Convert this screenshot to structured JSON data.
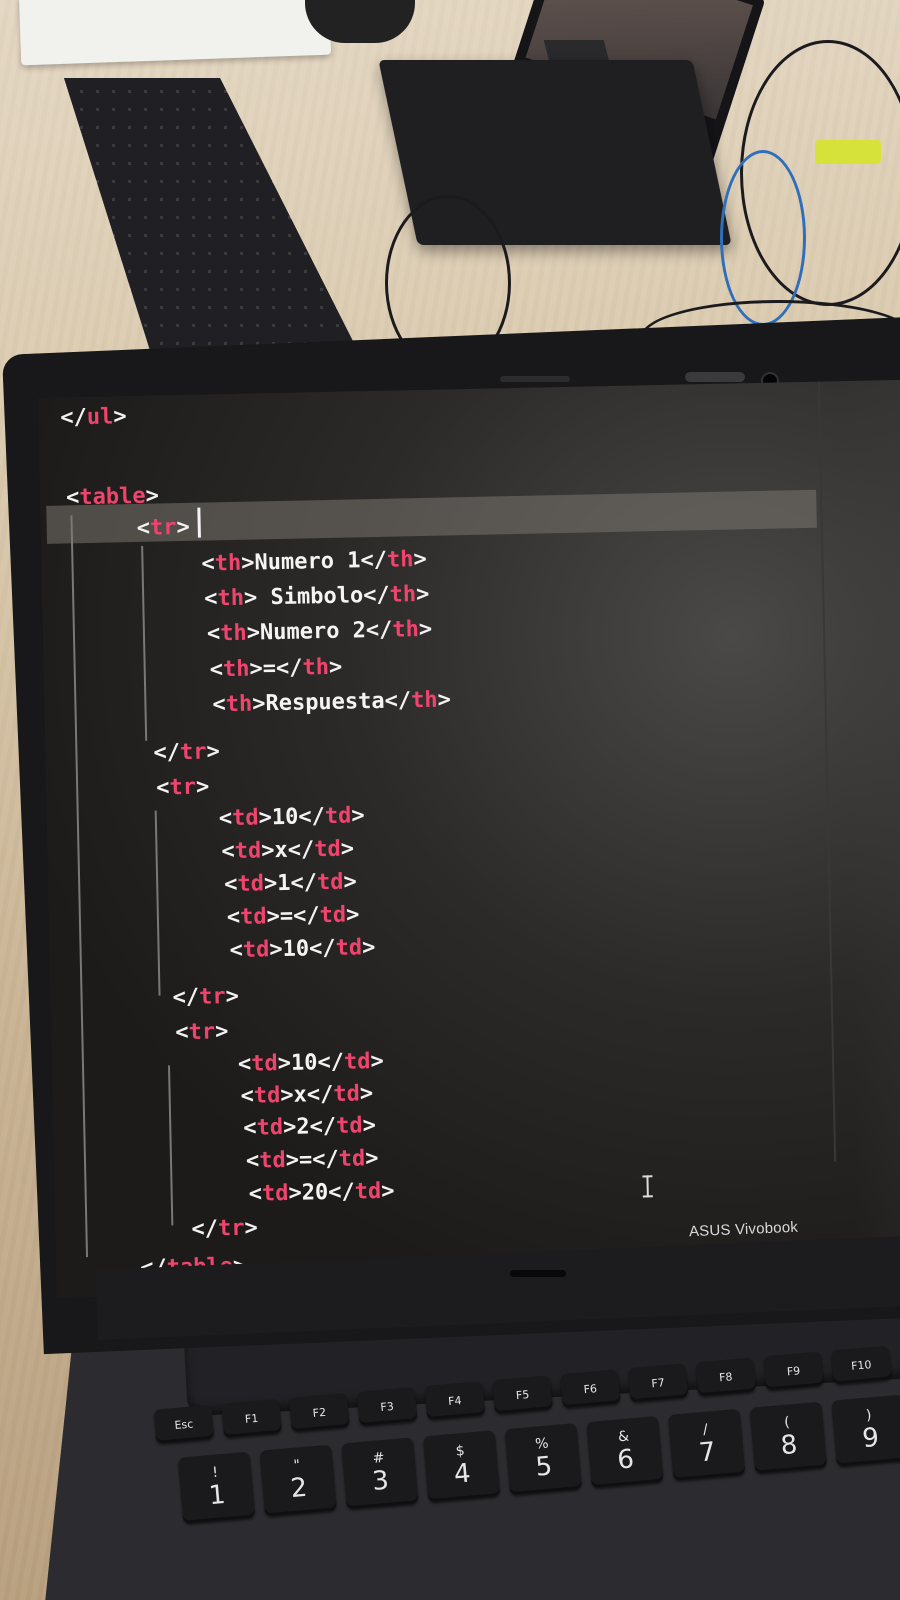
{
  "editor": {
    "lines": [
      {
        "indent": 0,
        "open": "</",
        "tag": "ul",
        "close": ">",
        "text": ""
      },
      {
        "indent": 0,
        "open": "<",
        "tag": "table",
        "close": ">",
        "text": ""
      },
      {
        "indent": 1,
        "open": "<",
        "tag": "tr",
        "close": ">",
        "text": ""
      },
      {
        "indent": 2,
        "open": "<",
        "tag": "th",
        "close": ">",
        "text": "Numero 1",
        "end": "th"
      },
      {
        "indent": 2,
        "open": "<",
        "tag": "th",
        "close": ">",
        "text": " Simbolo",
        "end": "th"
      },
      {
        "indent": 2,
        "open": "<",
        "tag": "th",
        "close": ">",
        "text": "Numero 2",
        "end": "th"
      },
      {
        "indent": 2,
        "open": "<",
        "tag": "th",
        "close": ">",
        "text": "=",
        "end": "th"
      },
      {
        "indent": 2,
        "open": "<",
        "tag": "th",
        "close": ">",
        "text": "Respuesta",
        "end": "th"
      },
      {
        "indent": 1,
        "open": "</",
        "tag": "tr",
        "close": ">",
        "text": ""
      },
      {
        "indent": 1,
        "open": "<",
        "tag": "tr",
        "close": ">",
        "text": ""
      },
      {
        "indent": 2,
        "open": "<",
        "tag": "td",
        "close": ">",
        "text": "10",
        "end": "td"
      },
      {
        "indent": 2,
        "open": "<",
        "tag": "td",
        "close": ">",
        "text": "x",
        "end": "td"
      },
      {
        "indent": 2,
        "open": "<",
        "tag": "td",
        "close": ">",
        "text": "1",
        "end": "td"
      },
      {
        "indent": 2,
        "open": "<",
        "tag": "td",
        "close": ">",
        "text": "=",
        "end": "td"
      },
      {
        "indent": 2,
        "open": "<",
        "tag": "td",
        "close": ">",
        "text": "10",
        "end": "td"
      },
      {
        "indent": 1,
        "open": "</",
        "tag": "tr",
        "close": ">",
        "text": ""
      },
      {
        "indent": 1,
        "open": "<",
        "tag": "tr",
        "close": ">",
        "text": ""
      },
      {
        "indent": 2,
        "open": "<",
        "tag": "td",
        "close": ">",
        "text": "10",
        "end": "td"
      },
      {
        "indent": 2,
        "open": "<",
        "tag": "td",
        "close": ">",
        "text": "x",
        "end": "td"
      },
      {
        "indent": 2,
        "open": "<",
        "tag": "td",
        "close": ">",
        "text": "2",
        "end": "td"
      },
      {
        "indent": 2,
        "open": "<",
        "tag": "td",
        "close": ">",
        "text": "=",
        "end": "td"
      },
      {
        "indent": 2,
        "open": "<",
        "tag": "td",
        "close": ">",
        "text": "20",
        "end": "td"
      },
      {
        "indent": 1,
        "open": "</",
        "tag": "tr",
        "close": ">",
        "text": ""
      },
      {
        "indent": 0,
        "open": "</",
        "tag": "table",
        "close": ">",
        "text": ""
      }
    ],
    "colors": {
      "tag": "#f0446d",
      "text": "#f2f2f2",
      "background": "#24221f"
    }
  },
  "laptop": {
    "brand": "ASUS Vivobook"
  },
  "keyboard": {
    "function_row": [
      "Esc",
      "F1",
      "F2",
      "F3",
      "F4",
      "F5",
      "F6",
      "F7",
      "F8",
      "F9",
      "F10"
    ],
    "number_row": [
      "1",
      "2",
      "3",
      "4",
      "5",
      "6",
      "7",
      "8",
      "9"
    ],
    "number_row_symbols": [
      "!",
      "\"",
      "#",
      "$",
      "%",
      "&",
      "/",
      "(",
      ")"
    ]
  }
}
